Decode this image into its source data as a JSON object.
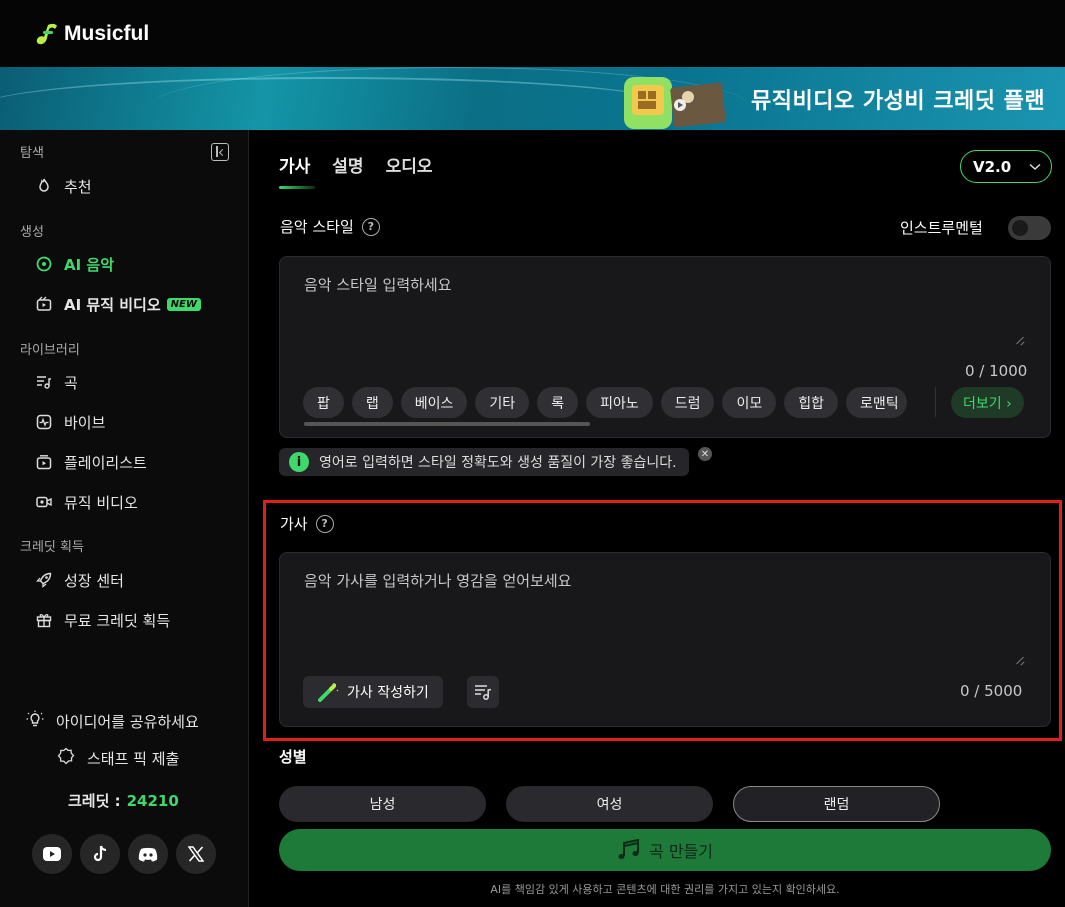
{
  "app": {
    "name": "Musicful"
  },
  "banner": {
    "text": "뮤직비디오 가성비 크레딧 플랜"
  },
  "sidebar": {
    "sections": [
      {
        "label": "탐색"
      },
      {
        "label": "생성"
      },
      {
        "label": "라이브러리"
      },
      {
        "label": "크레딧 획득"
      }
    ],
    "items": [
      {
        "label": "추천",
        "icon": "fire-icon"
      },
      {
        "label": "AI 음악",
        "icon": "disc-icon",
        "active": true
      },
      {
        "label": "AI 뮤직 비디오",
        "icon": "video-clip-icon",
        "badge": "NEW"
      },
      {
        "label": "곡",
        "icon": "song-list-icon"
      },
      {
        "label": "바이브",
        "icon": "pulse-icon"
      },
      {
        "label": "플레이리스트",
        "icon": "playlist-icon"
      },
      {
        "label": "뮤직 비디오",
        "icon": "camera-icon"
      },
      {
        "label": "성장 센터",
        "icon": "rocket-icon"
      },
      {
        "label": "무료 크레딧 획득",
        "icon": "gift-icon"
      }
    ],
    "idea": "아이디어를 공유하세요",
    "staff_pick": "스태프 픽 제출",
    "credit_label": "크레딧 :",
    "credit_value": "24210",
    "social": [
      "youtube-icon",
      "tiktok-icon",
      "discord-icon",
      "x-icon"
    ]
  },
  "main": {
    "tabs": [
      {
        "label": "가사",
        "active": true
      },
      {
        "label": "설명"
      },
      {
        "label": "오디오"
      }
    ],
    "version": "V2.0",
    "style": {
      "label": "음악 스타일",
      "instrumental_label": "인스트루멘털",
      "instrumental_on": false,
      "placeholder": "음악 스타일 입력하세요",
      "counter": "0 / 1000",
      "chips": [
        "팝",
        "랩",
        "베이스",
        "기타",
        "록",
        "피아노",
        "드럼",
        "이모",
        "힙합",
        "로맨틱"
      ],
      "more": "더보기 ›"
    },
    "tip": "영어로 입력하면 스타일 정확도와 생성 품질이 가장 좋습니다.",
    "lyrics": {
      "label": "가사",
      "placeholder": "음악 가사를 입력하거나 영감을 얻어보세요",
      "write_button": "가사 작성하기",
      "counter": "0 / 5000"
    },
    "gender": {
      "label": "성별",
      "options": [
        "남성",
        "여성",
        "랜덤"
      ],
      "selected": "랜덤"
    },
    "create_button": "곡 만들기",
    "disclaimer": "AI를 책임감 있게 사용하고 콘텐츠에 대한 권리를 가지고 있는지 확인하세요."
  },
  "colors": {
    "accent": "#3fd96b",
    "highlight": "#e31d1d",
    "create_bg": "#1e7a38"
  }
}
